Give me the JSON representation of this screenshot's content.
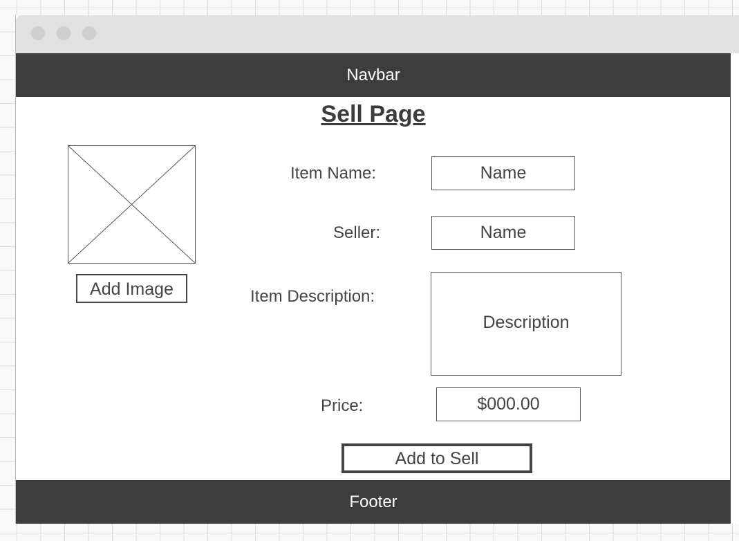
{
  "navbar": {
    "label": "Navbar"
  },
  "page": {
    "title": "Sell Page"
  },
  "image": {
    "add_button_label": "Add Image"
  },
  "form": {
    "item_name": {
      "label": "Item Name:",
      "placeholder": "Name"
    },
    "seller": {
      "label": "Seller:",
      "placeholder": "Name"
    },
    "description": {
      "label": "Item Description:",
      "placeholder": "Description"
    },
    "price": {
      "label": "Price:",
      "placeholder": "$000.00"
    },
    "submit_label": "Add to Sell"
  },
  "footer": {
    "label": "Footer"
  }
}
